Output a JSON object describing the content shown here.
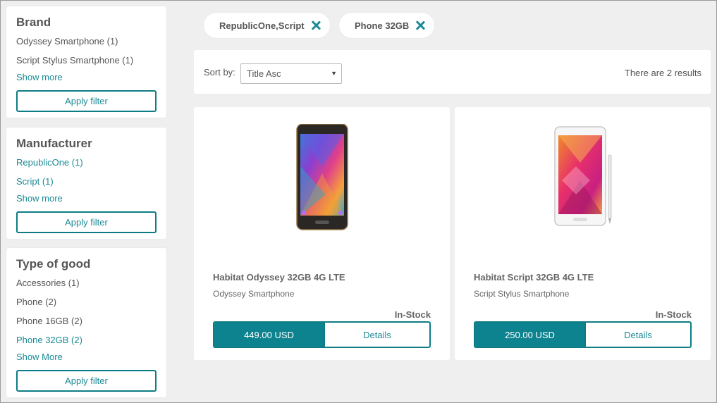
{
  "filters": [
    {
      "title": "Brand",
      "items": [
        {
          "label": "Odyssey Smartphone (1)",
          "active": false
        },
        {
          "label": "Script Stylus Smartphone (1)",
          "active": false
        }
      ],
      "show_more": "Show more",
      "apply": "Apply filter"
    },
    {
      "title": "Manufacturer",
      "items": [
        {
          "label": "RepublicOne (1)",
          "active": true
        },
        {
          "label": "Script (1)",
          "active": true
        }
      ],
      "show_more": "Show more",
      "apply": "Apply filter"
    },
    {
      "title": "Type of good",
      "items": [
        {
          "label": "Accessories (1)",
          "active": false
        },
        {
          "label": "Phone (2)",
          "active": false
        },
        {
          "label": "Phone 16GB (2)",
          "active": false
        },
        {
          "label": "Phone 32GB (2)",
          "active": true
        }
      ],
      "show_more": "Show More",
      "apply": "Apply filter"
    }
  ],
  "chips": [
    {
      "label": "RepublicOne,Script",
      "icon": "close-icon"
    },
    {
      "label": "Phone 32GB",
      "icon": "close-icon"
    }
  ],
  "sort": {
    "label": "Sort by:",
    "selected": "Title Asc",
    "results": "There are 2 results"
  },
  "products": [
    {
      "title": "Habitat Odyssey 32GB 4G LTE",
      "brand": "Odyssey Smartphone",
      "stock": "In-Stock",
      "price": "449.00 USD",
      "details": "Details",
      "image": "black-smartphone-image"
    },
    {
      "title": "Habitat Script 32GB 4G LTE",
      "brand": "Script Stylus Smartphone",
      "stock": "In-Stock",
      "price": "250.00 USD",
      "details": "Details",
      "image": "white-stylus-smartphone-image"
    }
  ],
  "colors": {
    "accent": "#0e8390",
    "link": "#1b8a95",
    "background": "#efefef"
  }
}
